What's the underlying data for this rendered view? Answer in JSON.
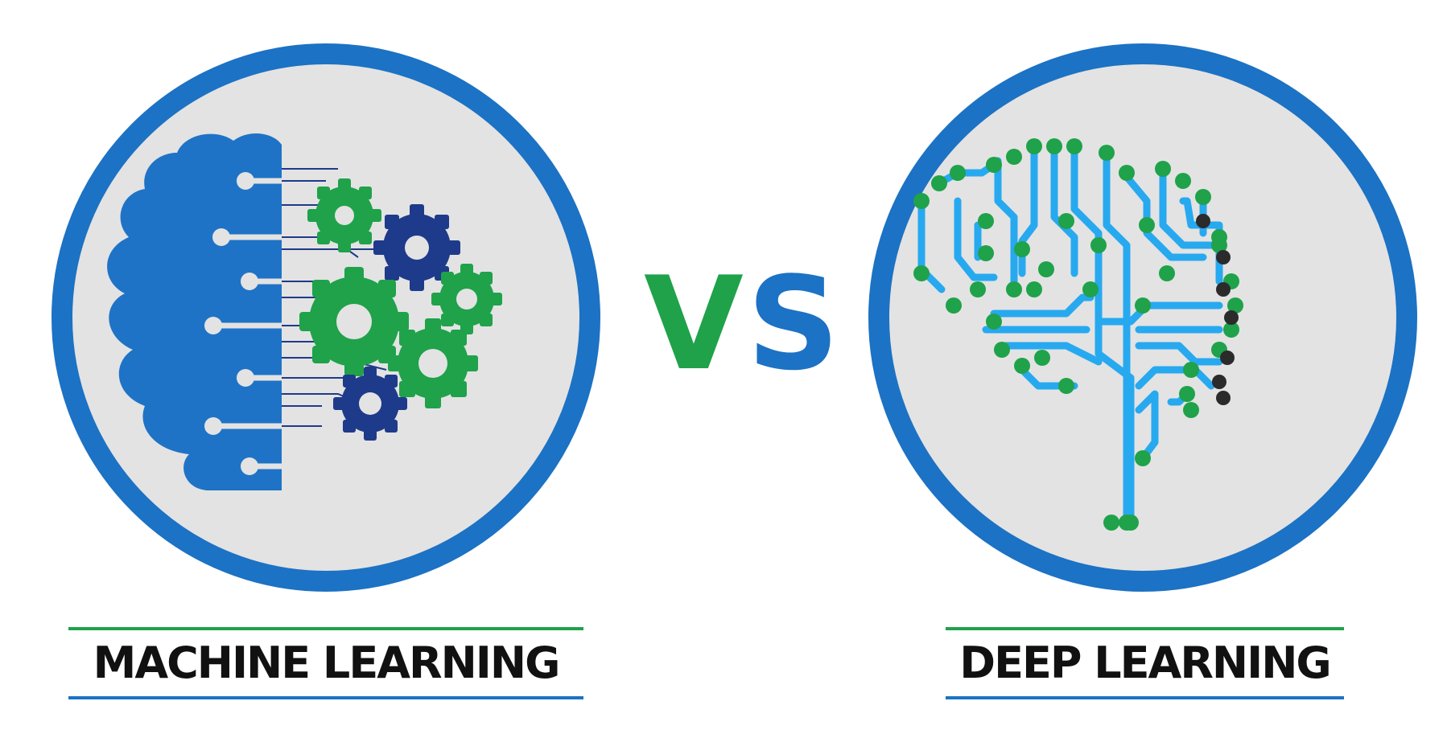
{
  "left_panel": {
    "caption": "MACHINE LEARNING",
    "icon": "brain-gears-icon"
  },
  "right_panel": {
    "caption": "DEEP LEARNING",
    "icon": "circuit-brain-icon"
  },
  "versus": {
    "letter_v": "V",
    "letter_s": "S"
  },
  "colors": {
    "ring_blue": "#1c72c4",
    "disc_gray": "#e3e3e3",
    "brain_blue": "#1f73c6",
    "gear_green": "#1fa24a",
    "gear_navy": "#1e3a8a",
    "circuit_cyan": "#27a9f0",
    "node_green": "#1fa24a",
    "node_dark": "#2b2b2b",
    "caption_text": "#111111",
    "rule_green": "#1fa24a",
    "rule_blue": "#1c72c4"
  }
}
